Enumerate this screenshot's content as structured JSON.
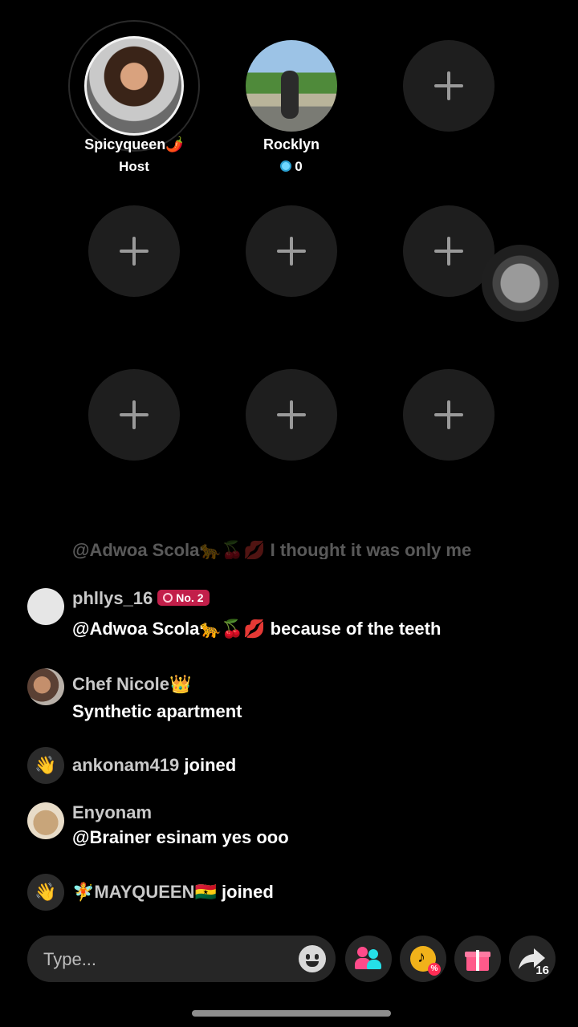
{
  "seats": {
    "host": {
      "name": "Spicyqueen🌶️",
      "role": "Host"
    },
    "guest": {
      "name": "Rocklyn",
      "count": "0"
    }
  },
  "chat": {
    "faded_message": "@Adwoa Scola🐆🍒💋 I thought it was only me",
    "messages": [
      {
        "user": "phllys_16",
        "badge": "No. 2",
        "text": "@Adwoa Scola🐆🍒💋 because of the teeth"
      },
      {
        "user": "Chef Nicole👑",
        "text": "Synthetic apartment"
      },
      {
        "user": "ankonam419",
        "suffix": "joined"
      },
      {
        "user": "Enyonam",
        "text": "@Brainer esinam yes ooo"
      },
      {
        "user": "🧚MAYQUEEN🇬🇭",
        "suffix": "joined"
      }
    ]
  },
  "input": {
    "placeholder": "Type..."
  },
  "share": {
    "count": "16"
  },
  "icons": {
    "add_seat": "plus-icon",
    "wave": "waving-hand-icon",
    "emoji": "smiley-icon",
    "guests": "people-icon",
    "coins": "coin-icon",
    "gift": "gift-icon",
    "share": "share-arrow-icon"
  },
  "colors": {
    "background": "#000000",
    "seat": "#1e1e1e",
    "badge": "#c21f4a",
    "gift": "#ff5a8a",
    "people": "#ff4b8a",
    "coin": "#f1b21a"
  }
}
